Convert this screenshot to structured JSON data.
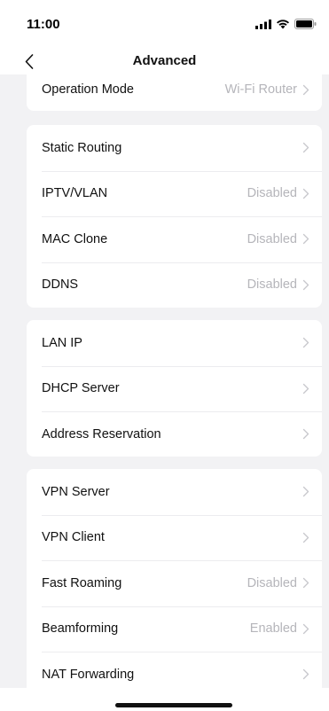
{
  "status_bar": {
    "time": "11:00",
    "icons": [
      "signal-icon",
      "wifi-icon",
      "battery-icon"
    ]
  },
  "nav": {
    "title": "Advanced",
    "back_icon": "chevron-left-icon"
  },
  "groups": [
    {
      "items": [
        {
          "label": "Operation Mode",
          "value": "Wi-Fi Router"
        }
      ]
    },
    {
      "items": [
        {
          "label": "Static Routing",
          "value": ""
        },
        {
          "label": "IPTV/VLAN",
          "value": "Disabled"
        },
        {
          "label": "MAC Clone",
          "value": "Disabled"
        },
        {
          "label": "DDNS",
          "value": "Disabled"
        }
      ]
    },
    {
      "items": [
        {
          "label": "LAN IP",
          "value": ""
        },
        {
          "label": "DHCP Server",
          "value": ""
        },
        {
          "label": "Address Reservation",
          "value": ""
        }
      ]
    },
    {
      "items": [
        {
          "label": "VPN Server",
          "value": ""
        },
        {
          "label": "VPN Client",
          "value": ""
        },
        {
          "label": "Fast Roaming",
          "value": "Disabled"
        },
        {
          "label": "Beamforming",
          "value": "Enabled"
        },
        {
          "label": "NAT Forwarding",
          "value": ""
        }
      ]
    }
  ],
  "colors": {
    "background": "#f2f2f4",
    "card": "#ffffff",
    "value_text": "#b5b5ba",
    "chevron": "#c7c7cc"
  }
}
